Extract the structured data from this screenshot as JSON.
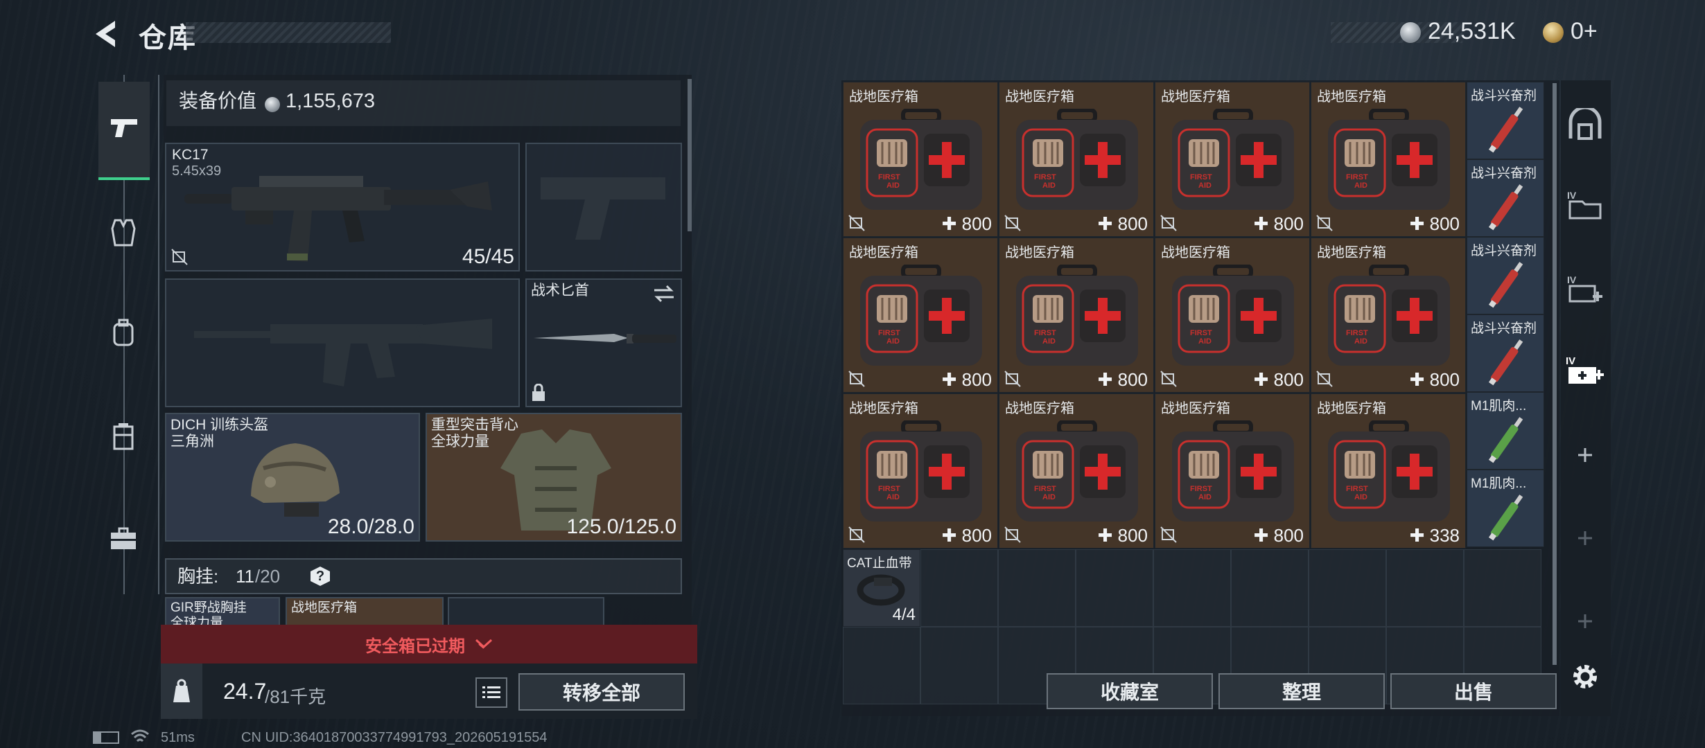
{
  "header": {
    "title": "仓库",
    "currency_silver": "24,531K",
    "currency_gold": "0+"
  },
  "left": {
    "equip_value_label": "装备价值",
    "equip_value": "1,155,673",
    "primary_weapon": {
      "name": "KC17",
      "caliber": "5.45x39",
      "ammo": "45/45"
    },
    "melee": {
      "name": "战术匕首"
    },
    "helmet": {
      "name": "DICH 训练头盔",
      "sub": "三角洲",
      "durability": "28.0/28.0"
    },
    "armor": {
      "name": "重型突击背心",
      "sub": "全球力量",
      "durability": "125.0/125.0"
    },
    "rig_label": "胸挂:",
    "rig_used": "11",
    "rig_total": "/20",
    "rig_help": "?",
    "rig_item1": "GIR野战胸挂",
    "rig_item1_sub": "全球力量",
    "rig_item2": "战地医疗箱",
    "expired_text": "安全箱已过期",
    "weight_current": "24.7",
    "weight_total": "/81千克",
    "transfer_all": "转移全部"
  },
  "grid": {
    "medkit_name": "战地医疗箱",
    "medkits": [
      "800",
      "800",
      "800",
      "800",
      "800",
      "800",
      "800",
      "800",
      "800",
      "800",
      "800",
      "338"
    ],
    "stim_items": [
      {
        "name": "战斗兴奋剂",
        "color": "#c23a34"
      },
      {
        "name": "战斗兴奋剂",
        "color": "#c23a34"
      },
      {
        "name": "战斗兴奋剂",
        "color": "#c23a34"
      },
      {
        "name": "战斗兴奋剂",
        "color": "#c23a34"
      },
      {
        "name": "M1肌肉...",
        "color": "#5aa148"
      },
      {
        "name": "M1肌肉...",
        "color": "#5aa148"
      }
    ],
    "tourniquet": {
      "name": "CAT止血带",
      "count": "4/4"
    },
    "buttons": {
      "collection": "收藏室",
      "sort": "整理",
      "sell": "出售"
    }
  },
  "status_bar": {
    "ping": "51ms",
    "uid": "CN UID:3640187003377499179​3_202605191554"
  }
}
